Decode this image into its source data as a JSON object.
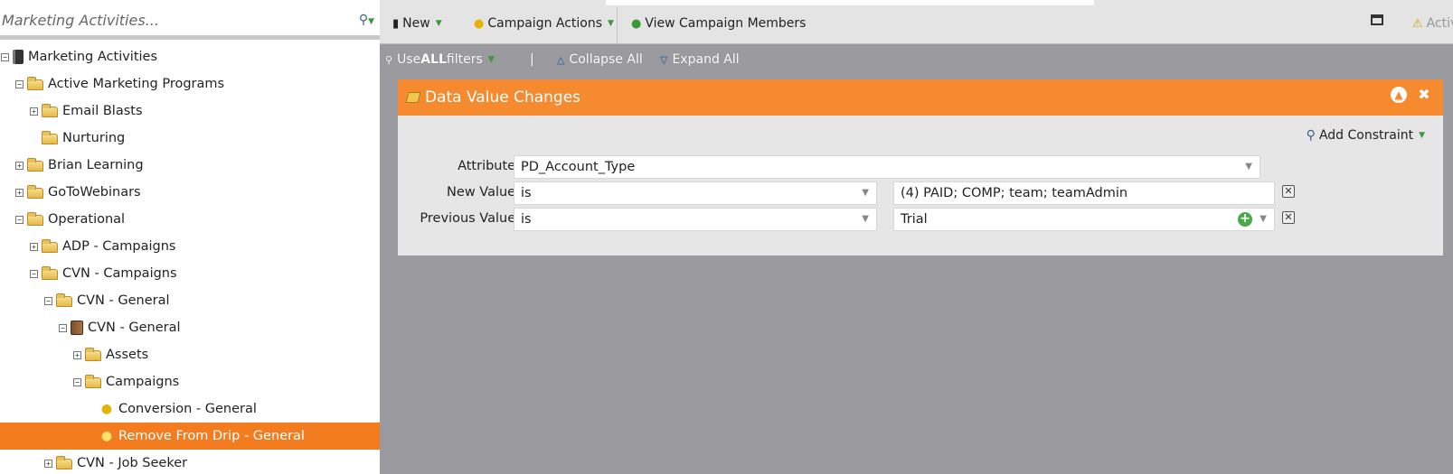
{
  "search": {
    "placeholder": "Marketing Activities..."
  },
  "tree": [
    {
      "label": "Marketing Activities",
      "toggle": "minus",
      "icon": "root",
      "indent": 0
    },
    {
      "label": "Active Marketing Programs",
      "toggle": "minus",
      "icon": "folder",
      "indent": 1
    },
    {
      "label": "Email Blasts",
      "toggle": "plus",
      "icon": "folder",
      "indent": 2
    },
    {
      "label": "Nurturing",
      "toggle": "none",
      "icon": "folder",
      "indent": 2
    },
    {
      "label": "Brian Learning",
      "toggle": "plus",
      "icon": "folder",
      "indent": 1
    },
    {
      "label": "GoToWebinars",
      "toggle": "plus",
      "icon": "folder",
      "indent": 1
    },
    {
      "label": "Operational",
      "toggle": "minus",
      "icon": "folder",
      "indent": 1
    },
    {
      "label": "ADP - Campaigns",
      "toggle": "plus",
      "icon": "folder",
      "indent": 2
    },
    {
      "label": "CVN - Campaigns",
      "toggle": "minus",
      "icon": "folder",
      "indent": 2
    },
    {
      "label": "CVN - General",
      "toggle": "minus",
      "icon": "folder",
      "indent": 3
    },
    {
      "label": "CVN - General",
      "toggle": "minus",
      "icon": "program",
      "indent": 4
    },
    {
      "label": "Assets",
      "toggle": "plus",
      "icon": "folder",
      "indent": 5
    },
    {
      "label": "Campaigns",
      "toggle": "minus",
      "icon": "folder",
      "indent": 5
    },
    {
      "label": "Conversion - General",
      "toggle": "none",
      "icon": "bulb",
      "indent": 6
    },
    {
      "label": "Remove From Drip - General",
      "toggle": "none",
      "icon": "bulb",
      "indent": 6,
      "selected": true
    },
    {
      "label": "CVN - Job Seeker",
      "toggle": "plus",
      "icon": "folder",
      "indent": 3
    }
  ],
  "toolbar": {
    "new_label": "New",
    "campaign_actions_label": "Campaign Actions",
    "view_members_label": "View Campaign Members",
    "active_label": "Activ"
  },
  "filterbar": {
    "use_prefix": "Use ",
    "use_all": "ALL",
    "use_suffix": " filters",
    "divider": "|",
    "collapse_all": "Collapse All",
    "expand_all": "Expand All"
  },
  "panel": {
    "title": "Data Value Changes",
    "add_constraint": "Add Constraint",
    "rows": [
      {
        "label": "Attribute:",
        "value": "PD_Account_Type"
      },
      {
        "label": "New Value:",
        "operator": "is",
        "value": "(4) PAID; COMP; team; teamAdmin"
      },
      {
        "label": "Previous Value:",
        "operator": "is",
        "value": "Trial"
      }
    ]
  },
  "colors": {
    "accent": "#f58a2e",
    "selected": "#f47c20",
    "workspace": "#9b9b9f"
  }
}
